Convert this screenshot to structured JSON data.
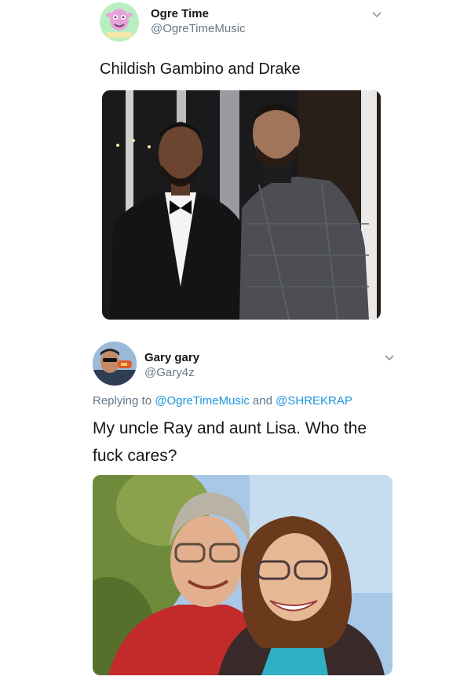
{
  "tweet1": {
    "name": "Ogre Time",
    "handle": "@OgreTimeMusic",
    "text": "Childish Gambino and Drake",
    "menu_icon": "chevron-down-icon"
  },
  "tweet2": {
    "name": "Gary gary",
    "handle": "@Gary4z",
    "reply_prefix": "Replying to",
    "reply_mention_1": "@OgreTimeMusic",
    "reply_and": "and",
    "reply_mention_2": "@SHREKRAP",
    "text_line1": "My uncle Ray and aunt Lisa. Who the",
    "text_line2": "fuck cares?",
    "menu_icon": "chevron-down-icon"
  },
  "colors": {
    "link": "#1b95e0",
    "secondary_text": "#657786",
    "primary_text": "#14171a"
  }
}
